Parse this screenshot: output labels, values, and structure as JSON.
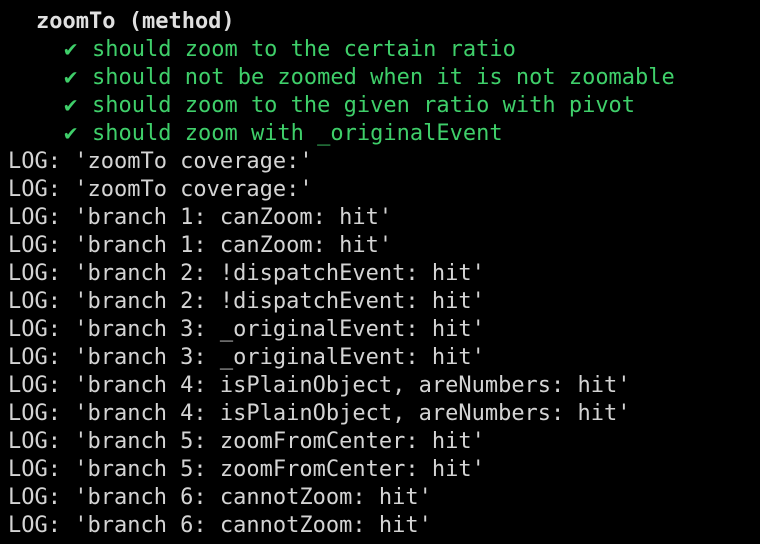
{
  "suite": {
    "title": "zoomTo (method)"
  },
  "tests": [
    {
      "mark": "✔",
      "label": "should zoom to the certain ratio"
    },
    {
      "mark": "✔",
      "label": "should not be zoomed when it is not zoomable"
    },
    {
      "mark": "✔",
      "label": "should zoom to the given ratio with pivot"
    },
    {
      "mark": "✔",
      "label": "should zoom with _originalEvent"
    }
  ],
  "logs": [
    "LOG: 'zoomTo coverage:'",
    "LOG: 'zoomTo coverage:'",
    "LOG: 'branch 1: canZoom: hit'",
    "LOG: 'branch 1: canZoom: hit'",
    "LOG: 'branch 2: !dispatchEvent: hit'",
    "LOG: 'branch 2: !dispatchEvent: hit'",
    "LOG: 'branch 3: _originalEvent: hit'",
    "LOG: 'branch 3: _originalEvent: hit'",
    "LOG: 'branch 4: isPlainObject, areNumbers: hit'",
    "LOG: 'branch 4: isPlainObject, areNumbers: hit'",
    "LOG: 'branch 5: zoomFromCenter: hit'",
    "LOG: 'branch 5: zoomFromCenter: hit'",
    "LOG: 'branch 6: cannotZoom: hit'",
    "LOG: 'branch 6: cannotZoom: hit'"
  ],
  "colors": {
    "background": "#000000",
    "text": "#d4d4d4",
    "pass": "#3fcf6a"
  }
}
